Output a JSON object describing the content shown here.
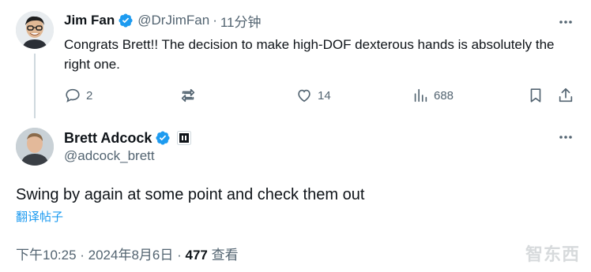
{
  "reply": {
    "author_name": "Jim Fan",
    "handle": "@DrJimFan",
    "separator": "·",
    "time_ago": "11分钟",
    "text": "Congrats Brett!! The decision to make high-DOF dexterous hands is absolutely the right one.",
    "actions": {
      "replies": "2",
      "likes": "14",
      "views": "688"
    }
  },
  "tweet": {
    "author_name": "Brett Adcock",
    "handle": "@adcock_brett",
    "text": "Swing by again at some point and check them out",
    "translate_label": "翻译帖子",
    "time": "下午10:25 · 2024年8月6日 · ",
    "views_count": "477",
    "views_label": " 查看"
  },
  "watermark": "智东西",
  "colors": {
    "verified": "#1d9bf0",
    "muted": "#536471",
    "link": "#1d9bf0",
    "text": "#0f1419"
  }
}
